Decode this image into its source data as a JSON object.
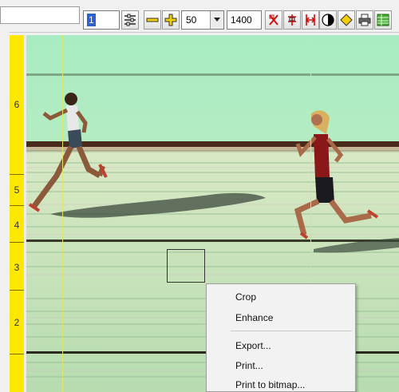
{
  "toolbar": {
    "frame_value": "1",
    "zoom_value": "50",
    "width_value": "1400",
    "buttons": [
      "lanes-icon",
      "zoom-out-icon",
      "zoom-in-icon",
      "flag-icon",
      "lane-marker-icon",
      "split-icon",
      "contrast-icon",
      "diamond-icon",
      "print-icon",
      "table-icon"
    ]
  },
  "lanes": [
    {
      "label": "6"
    },
    {
      "label": "5"
    },
    {
      "label": "4"
    },
    {
      "label": "3"
    },
    {
      "label": "2"
    }
  ],
  "context_menu": {
    "items": [
      "Crop",
      "Enhance",
      "Export...",
      "Print...",
      "Print to bitmap..."
    ]
  },
  "colors": {
    "ruler": "#ffe800",
    "time_line": "#e0e85a",
    "track_green": "#bfe9c6"
  }
}
